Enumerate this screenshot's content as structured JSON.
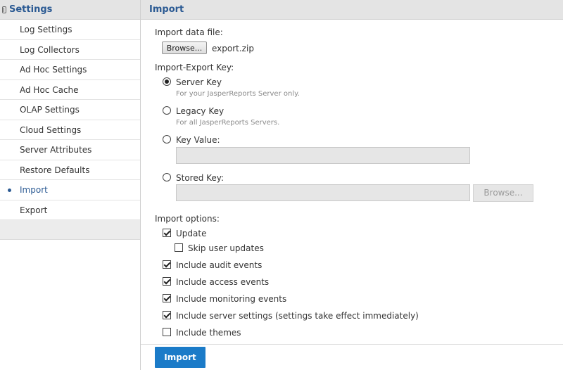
{
  "sidebar": {
    "title": "Settings",
    "items": [
      {
        "label": "Log Settings"
      },
      {
        "label": "Log Collectors"
      },
      {
        "label": "Ad Hoc Settings"
      },
      {
        "label": "Ad Hoc Cache"
      },
      {
        "label": "OLAP Settings"
      },
      {
        "label": "Cloud Settings"
      },
      {
        "label": "Server Attributes"
      },
      {
        "label": "Restore Defaults"
      },
      {
        "label": "Import"
      },
      {
        "label": "Export"
      }
    ],
    "active_item": "Import"
  },
  "main": {
    "title": "Import",
    "import_file": {
      "label": "Import data file:",
      "browse_label": "Browse...",
      "file_name": "export.zip"
    },
    "key": {
      "label": "Import-Export Key:",
      "server": {
        "label": "Server Key",
        "hint": "For your JasperReports Server only.",
        "selected": true
      },
      "legacy": {
        "label": "Legacy Key",
        "hint": "For all JasperReports Servers.",
        "selected": false
      },
      "value": {
        "label": "Key Value:",
        "value": "",
        "selected": false
      },
      "stored": {
        "label": "Stored Key:",
        "value": "",
        "browse_label": "Browse...",
        "selected": false
      }
    },
    "options": {
      "label": "Import options:",
      "update": {
        "label": "Update",
        "checked": true
      },
      "skip_user_updates": {
        "label": "Skip user updates",
        "checked": false
      },
      "audit_events": {
        "label": "Include audit events",
        "checked": true
      },
      "access_events": {
        "label": "Include access events",
        "checked": true
      },
      "monitoring_events": {
        "label": "Include monitoring events",
        "checked": true
      },
      "server_settings": {
        "label": "Include server settings (settings take effect immediately)",
        "checked": true
      },
      "themes": {
        "label": "Include themes",
        "checked": false
      }
    },
    "import_button": "Import"
  },
  "colors": {
    "accent": "#2b5a93",
    "primary_button": "#1b7bc8",
    "header_bg": "#e4e4e4"
  }
}
